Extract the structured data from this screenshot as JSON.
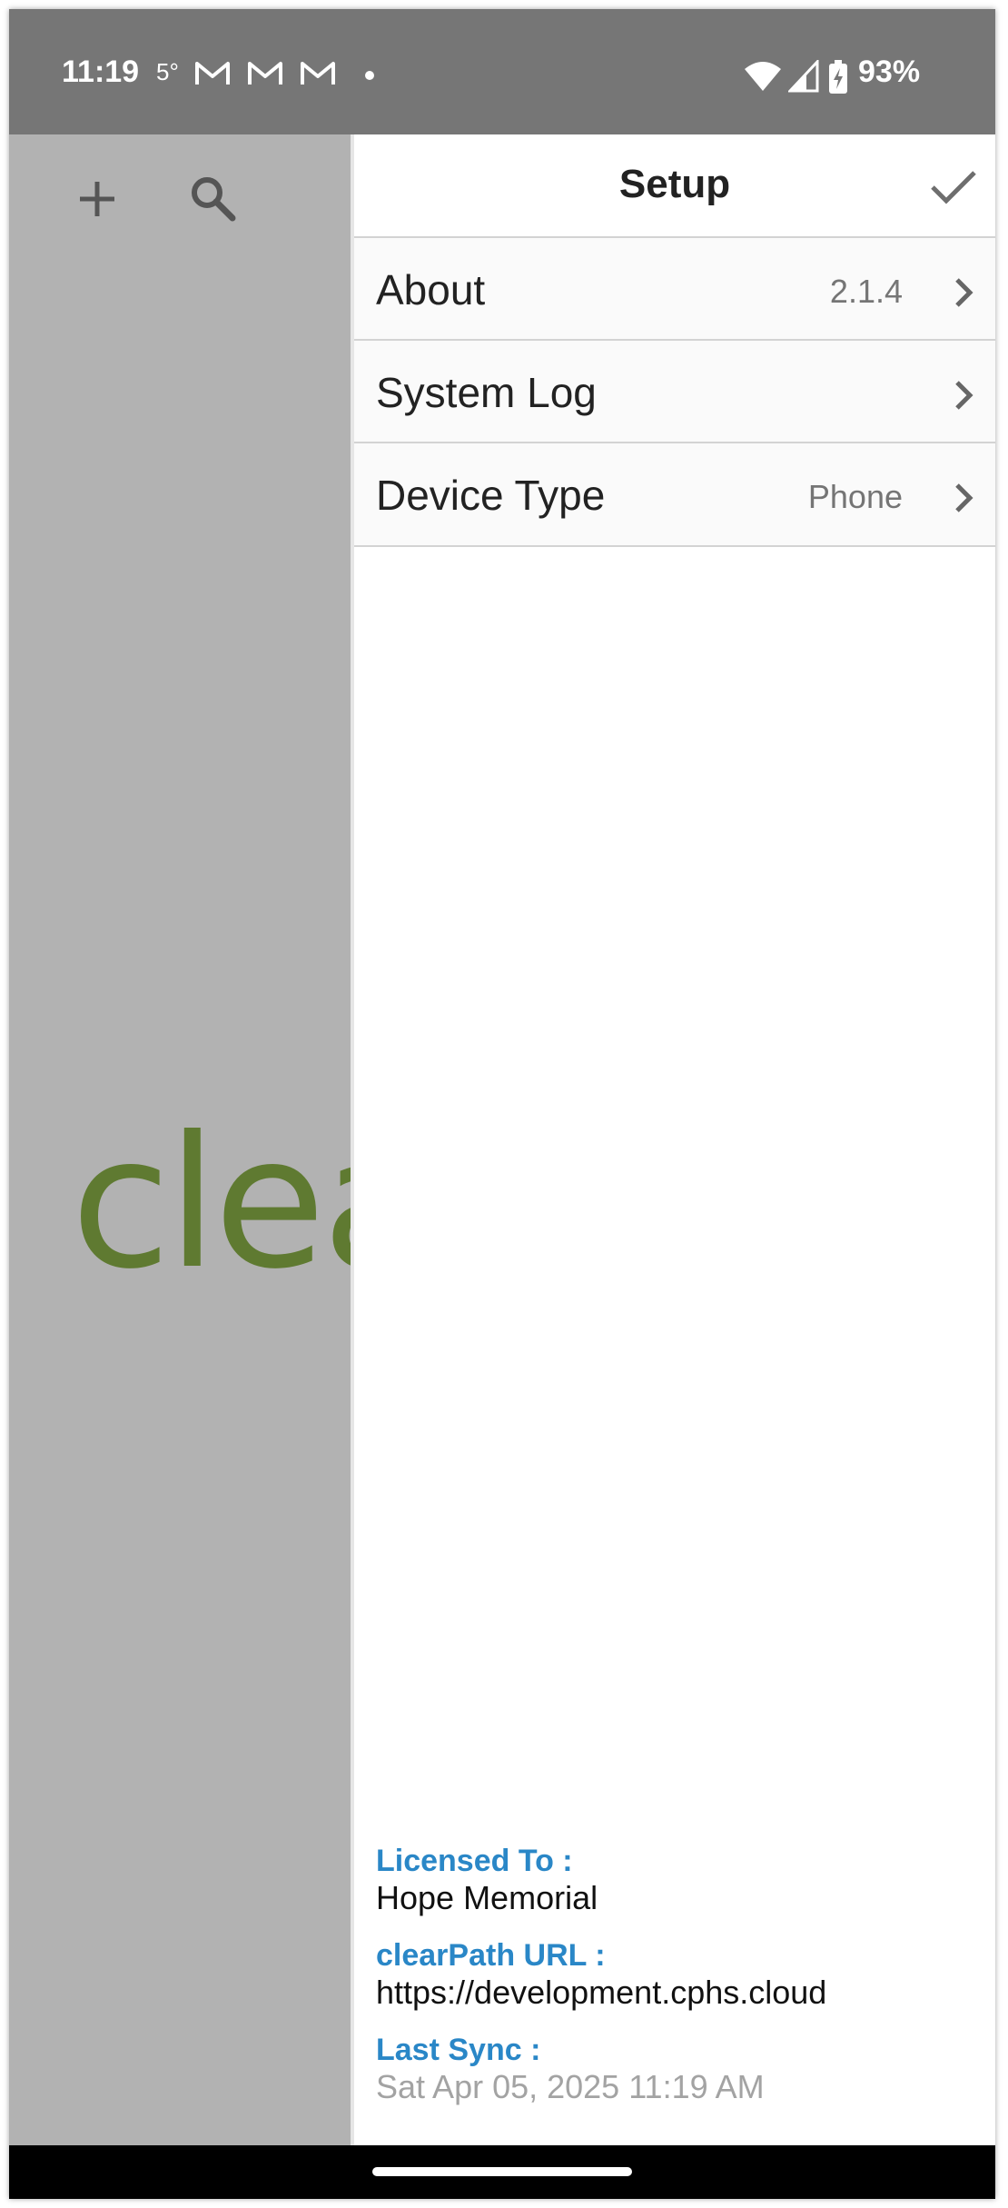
{
  "status_bar": {
    "time": "11:19",
    "temperature": "5°",
    "notification_icons": [
      "gmail-icon",
      "gmail-icon",
      "gmail-icon"
    ],
    "battery_percent": "93%",
    "color": "#767676"
  },
  "background_app": {
    "logo_text": "clea",
    "logo_color": "#5f7a31",
    "icons": [
      "add-icon",
      "search-icon"
    ]
  },
  "setup": {
    "title": "Setup",
    "done_icon": "checkmark-icon",
    "rows": [
      {
        "label": "About",
        "value": "2.1.4"
      },
      {
        "label": "System Log",
        "value": ""
      },
      {
        "label": "Device Type",
        "value": "Phone"
      }
    ],
    "footer": {
      "licensed_to_label": "Licensed To :",
      "licensed_to_value": "Hope Memorial",
      "url_label": "clearPath URL :",
      "url_value": "https://development.cphs.cloud",
      "last_sync_label": "Last Sync :",
      "last_sync_value": "Sat Apr 05, 2025 11:19 AM",
      "label_color": "#2a87c7"
    }
  }
}
